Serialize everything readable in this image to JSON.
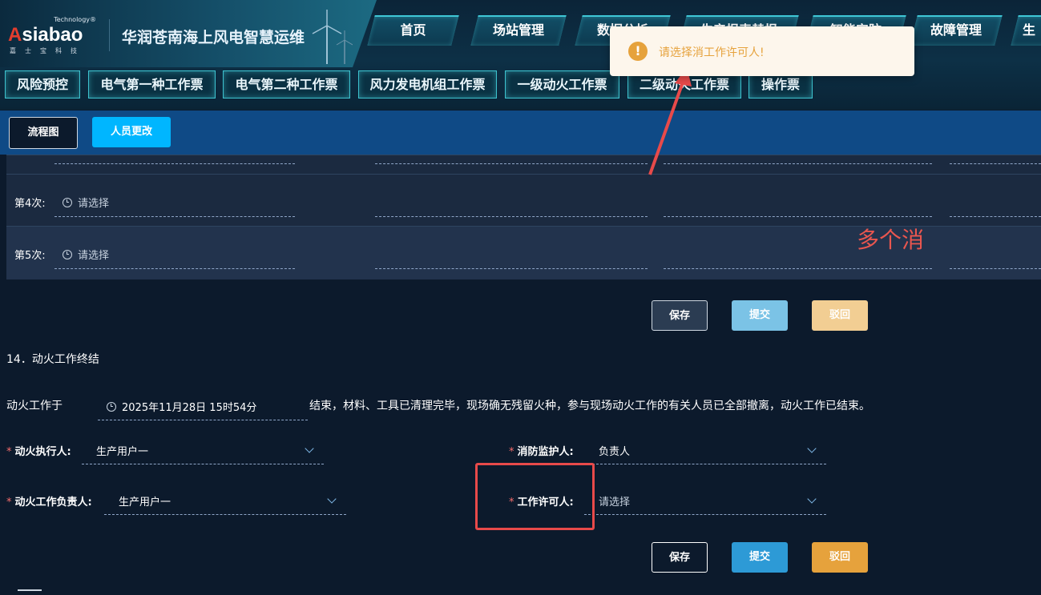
{
  "header": {
    "logo_tech": "Technology®",
    "logo_word_a": "A",
    "logo_word_rest": "siabao",
    "logo_sub": "嘉士宝科技",
    "title": "华润苍南海上风电智慧运维"
  },
  "nav": {
    "tabs": [
      "首页",
      "场站管理",
      "数据分析",
      "生产报表替报",
      "智能安防",
      "故障管理",
      "生"
    ]
  },
  "subnav": {
    "tabs": [
      "风险预控",
      "电气第一种工作票",
      "电气第二种工作票",
      "风力发电机组工作票",
      "一级动火工作票",
      "二级动火工作票",
      "操作票"
    ]
  },
  "toolbar": {
    "flow_label": "流程图",
    "person_change_label": "人员更改"
  },
  "table": {
    "rows": [
      {
        "label": "第4次:",
        "placeholder": "请选择"
      },
      {
        "label": "第5次:",
        "placeholder": "请选择"
      }
    ]
  },
  "actions_top": {
    "save": "保存",
    "submit": "提交",
    "reject": "驳回"
  },
  "section14": {
    "title": "14．动火工作终结",
    "prefix": "动火工作于",
    "datetime": "2025年11月28日 15时54分",
    "suffix": "结束，材料、工具已清理完毕，现场确无残留火种，参与现场动火工作的有关人员已全部撤离，动火工作已结束。",
    "executor_label": "动火执行人:",
    "executor_value": "生产用户一",
    "fire_monitor_label": "消防监护人:",
    "fire_monitor_value": "负责人",
    "leader_label": "动火工作负责人:",
    "leader_value": "生产用户一",
    "permit_label": "工作许可人:",
    "permit_placeholder": "请选择",
    "required_mark": "*"
  },
  "actions_bottom": {
    "save": "保存",
    "submit": "提交",
    "reject": "驳回"
  },
  "toast": {
    "icon": "!",
    "message": "请选择消工作许可人!"
  },
  "annotation": {
    "text": "多个消"
  },
  "colors": {
    "accent": "#00b6ff",
    "warning": "#e6a23c",
    "annotation_red": "#e84a4a",
    "toolbar_blue": "#0f4a86"
  }
}
